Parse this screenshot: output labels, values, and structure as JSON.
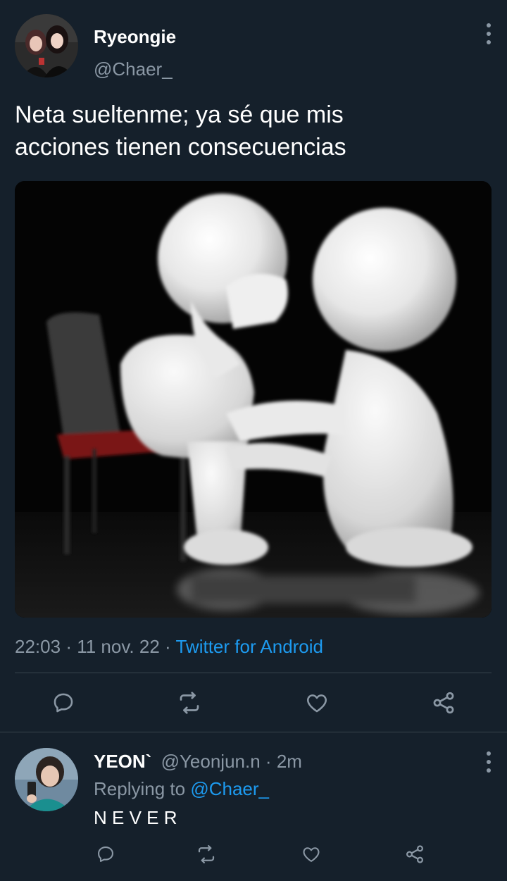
{
  "tweet": {
    "author_name": "Ryeongie",
    "author_handle": "@Chaer_",
    "text_line1": "Neta sueltenme; ya sé que mis",
    "text_line2": "acciones tienen consecuencias",
    "time": "22:03",
    "separator1": "·",
    "date": "11 nov. 22",
    "separator2": "·",
    "source": "Twitter for Android",
    "actions": [
      "reply-icon",
      "retweet-icon",
      "like-icon",
      "share-icon"
    ]
  },
  "reply": {
    "author_name": "YEON`",
    "author_handle": "@Yeonjun.n",
    "separator": "·",
    "age": "2m",
    "replying_prefix": "Replying to",
    "replying_to": "@Chaer_",
    "text": "N E V E R",
    "actions": [
      "reply-icon",
      "retweet-icon",
      "like-icon",
      "share-icon"
    ]
  },
  "colors": {
    "background": "#15202b",
    "muted": "#8b98a5",
    "link": "#1d9bf0",
    "divider": "#38444d"
  }
}
